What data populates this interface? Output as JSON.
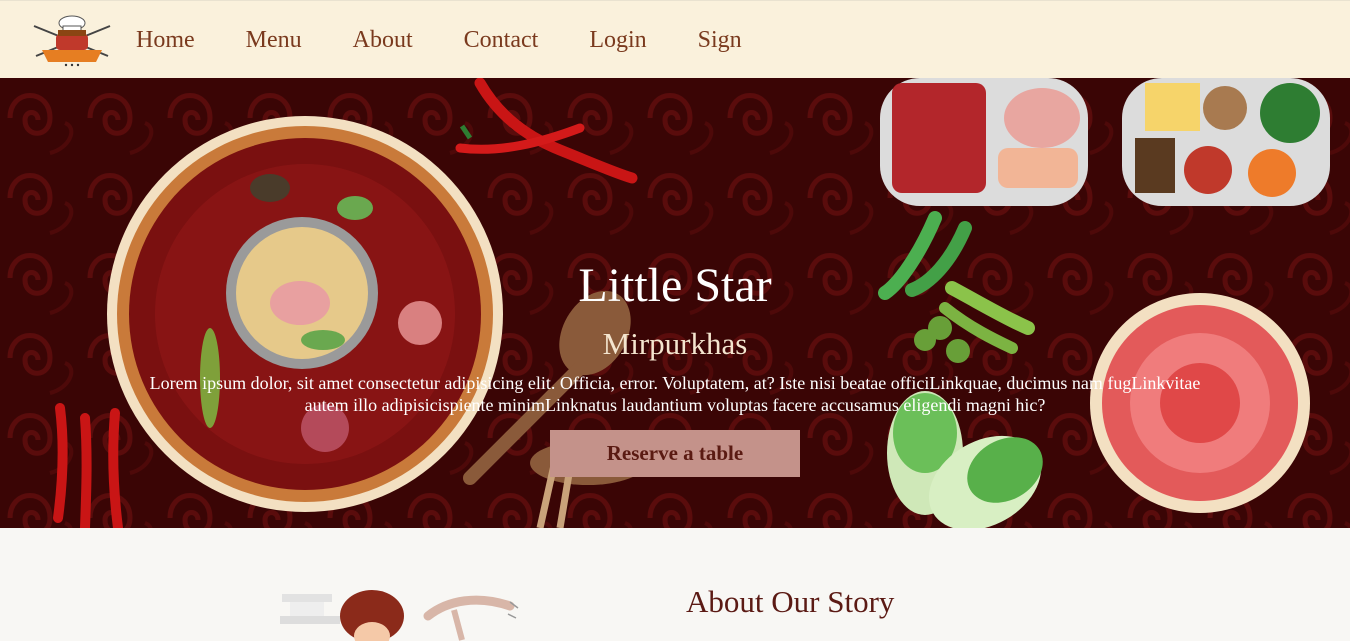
{
  "nav": {
    "logo_icon": "chef-hat-grill-logo",
    "links": [
      "Home",
      "Menu",
      "About",
      "Contact",
      "Login",
      "Sign"
    ]
  },
  "hero": {
    "title": "Little Star",
    "subtitle": "Mirpurkhas",
    "text": "Lorem ipsum dolor, sit amet consectetur adipisicing elit. Officia, error. Voluptatem, at? Iste nisi beatae officiLinkquae, ducimus nam fugLinkvitae autem illo adipisicispiente minimLinknatus laudantium voluptas facere accusamus eligendi magni hic?",
    "button_label": "Reserve a table"
  },
  "about": {
    "title": "About Our Story"
  },
  "colors": {
    "nav_bg": "#faf1dc",
    "nav_link": "#7a3a1e",
    "hero_bg": "#3a0505",
    "button_bg": "#c4928a",
    "button_text": "#5a1a12",
    "about_title": "#5b1a14"
  }
}
